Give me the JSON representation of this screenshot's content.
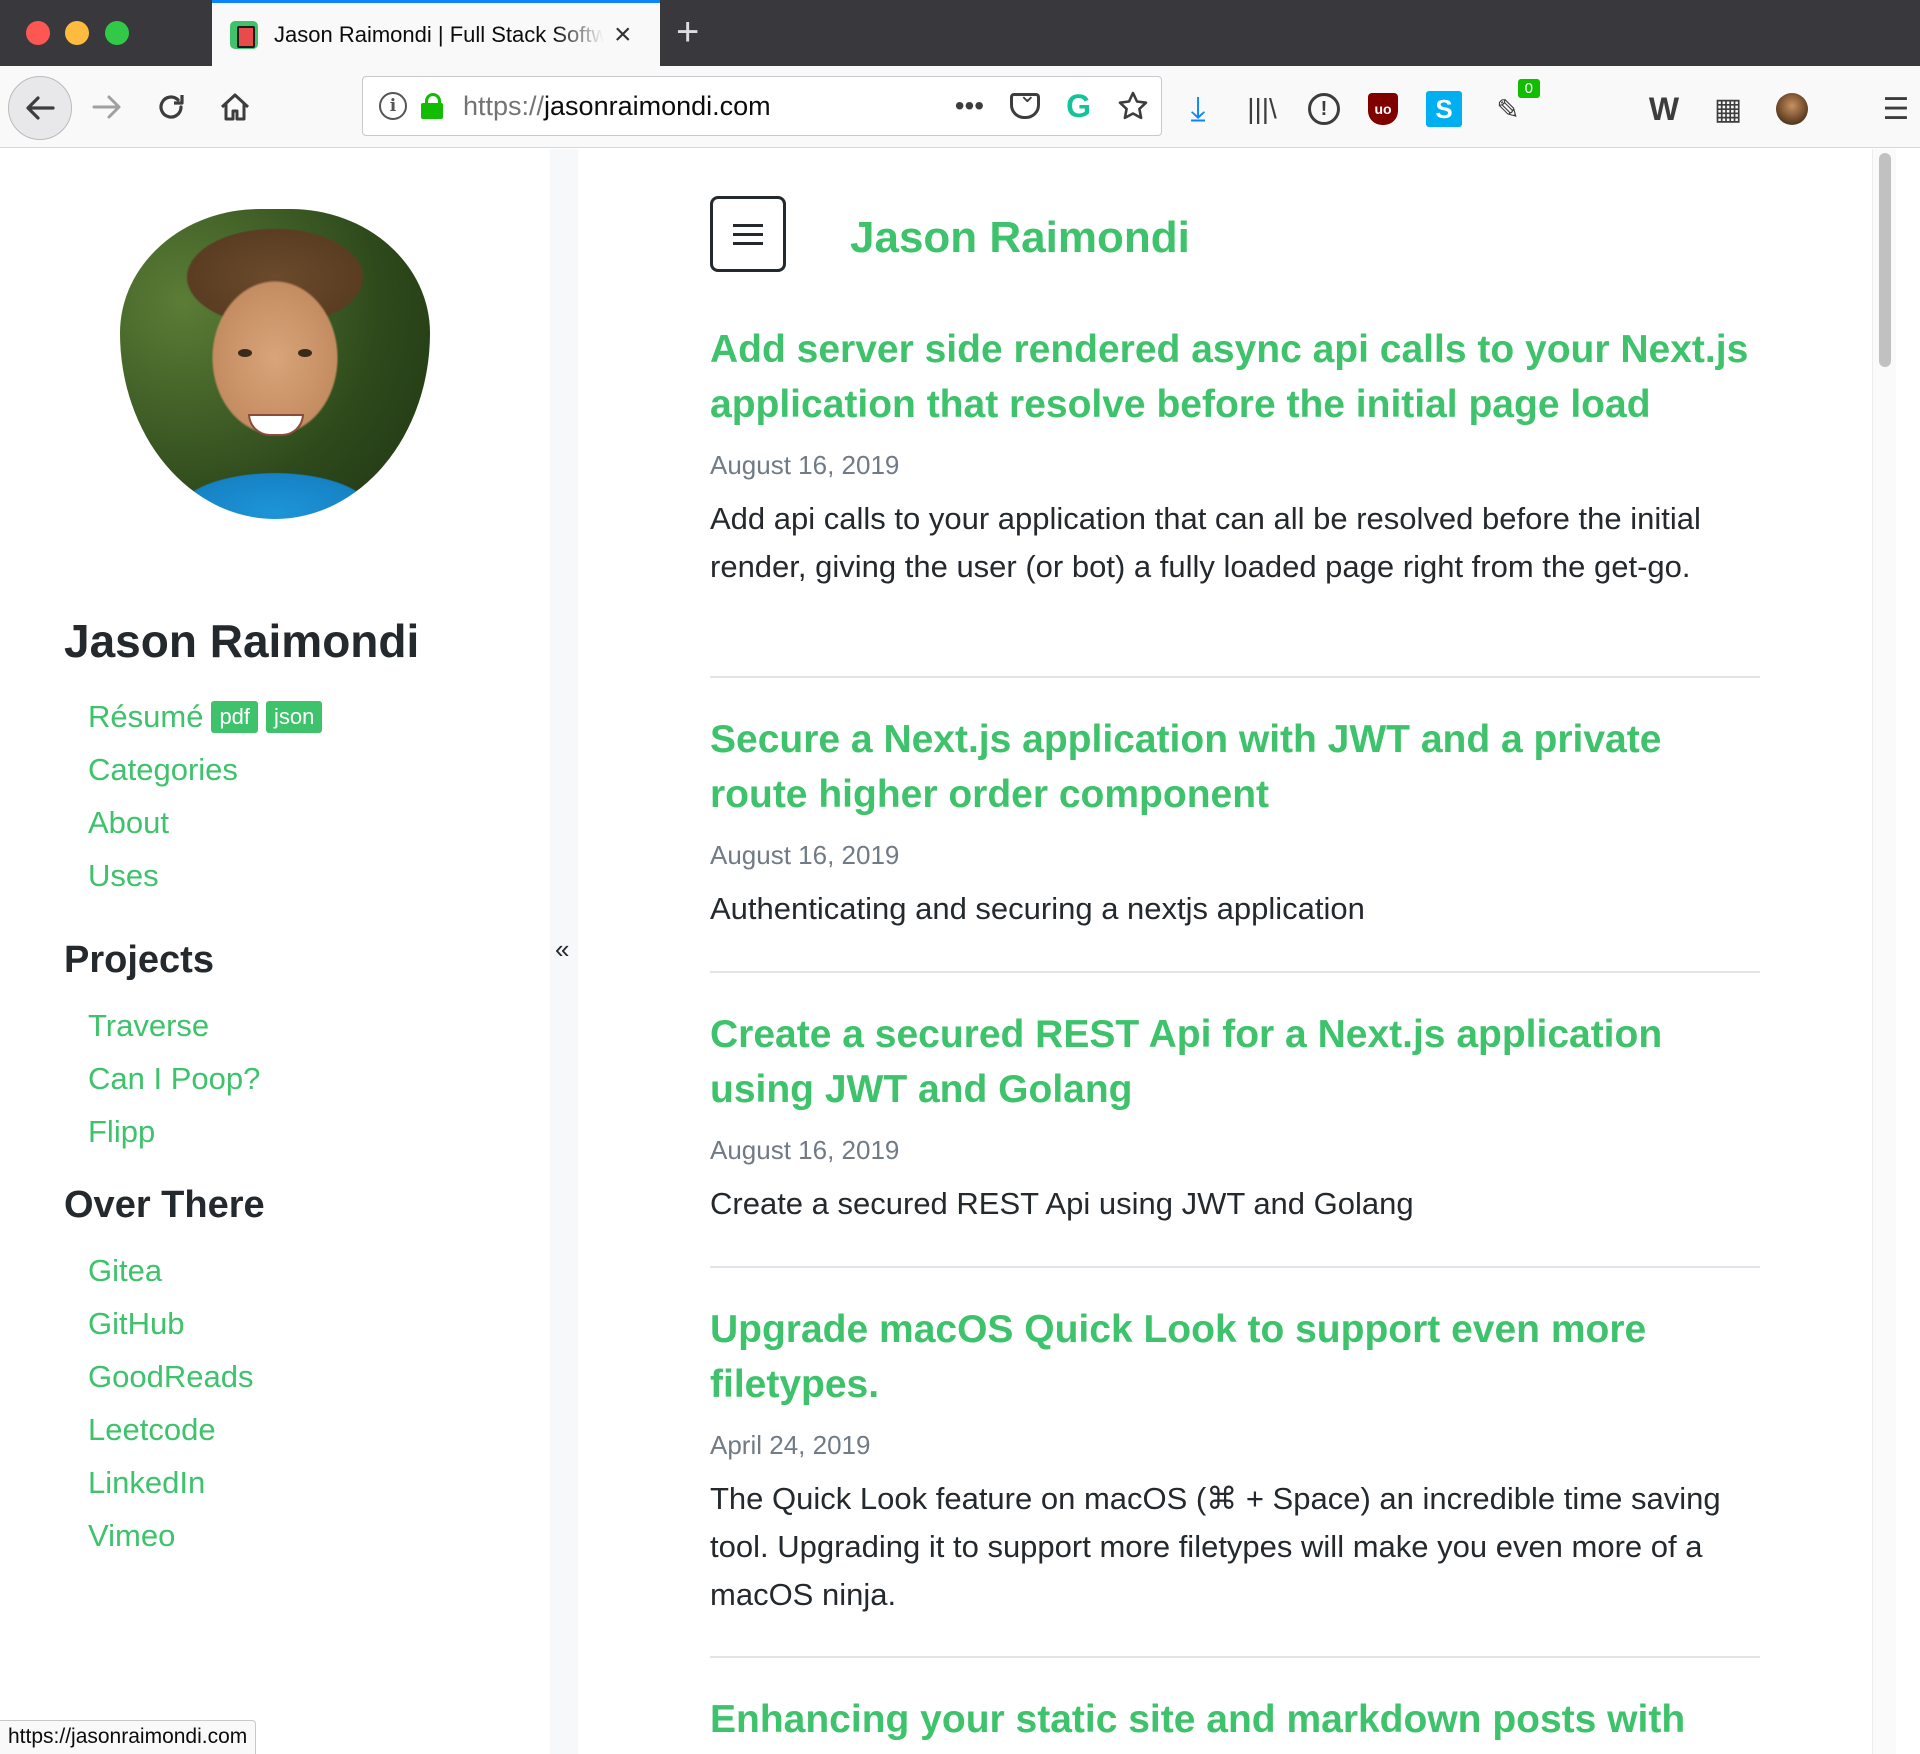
{
  "browser": {
    "tab_title": "Jason Raimondi | Full Stack Software Engineer",
    "url_protocol": "https://",
    "url_host": "jasonraimondi.com",
    "extension_badge": "0",
    "status_url": "https://jasonraimondi.com"
  },
  "sidebar": {
    "name": "Jason Raimondi",
    "nav": [
      {
        "label": "Résumé",
        "badges": [
          "pdf",
          "json"
        ]
      },
      {
        "label": "Categories"
      },
      {
        "label": "About"
      },
      {
        "label": "Uses"
      }
    ],
    "projects_heading": "Projects",
    "projects": [
      "Traverse",
      "Can I Poop?",
      "Flipp"
    ],
    "over_there_heading": "Over There",
    "links": [
      "Gitea",
      "GitHub",
      "GoodReads",
      "Leetcode",
      "LinkedIn",
      "Vimeo"
    ],
    "collapse_glyph": "«"
  },
  "main": {
    "title": "Jason Raimondi",
    "posts": [
      {
        "title": "Add server side rendered async api calls to your Next.js application that resolve before the initial page load",
        "date": "August 16, 2019",
        "excerpt": "Add api calls to your application that can all be resolved before the initial render, giving the user (or bot) a fully loaded page right from the get-go."
      },
      {
        "title": "Secure a Next.js application with JWT and a private route higher order component",
        "date": "August 16, 2019",
        "excerpt": "Authenticating and securing a nextjs application"
      },
      {
        "title": "Create a secured REST Api for a Next.js application using JWT and Golang",
        "date": "August 16, 2019",
        "excerpt": "Create a secured REST Api using JWT and Golang"
      },
      {
        "title": "Upgrade macOS Quick Look to support even more filetypes.",
        "date": "April 24, 2019",
        "excerpt": "The Quick Look feature on macOS (⌘ + Space) an incredible time saving tool. Upgrading it to support more filetypes will make you even more of a macOS ninja."
      },
      {
        "title": "Enhancing your static site and markdown posts with",
        "date": "",
        "excerpt": ""
      }
    ]
  },
  "colors": {
    "accent": "#3ec26b",
    "text": "#24292e",
    "muted": "#707b85",
    "chrome_dark": "#38383d",
    "focus_blue": "#0a84ff"
  }
}
